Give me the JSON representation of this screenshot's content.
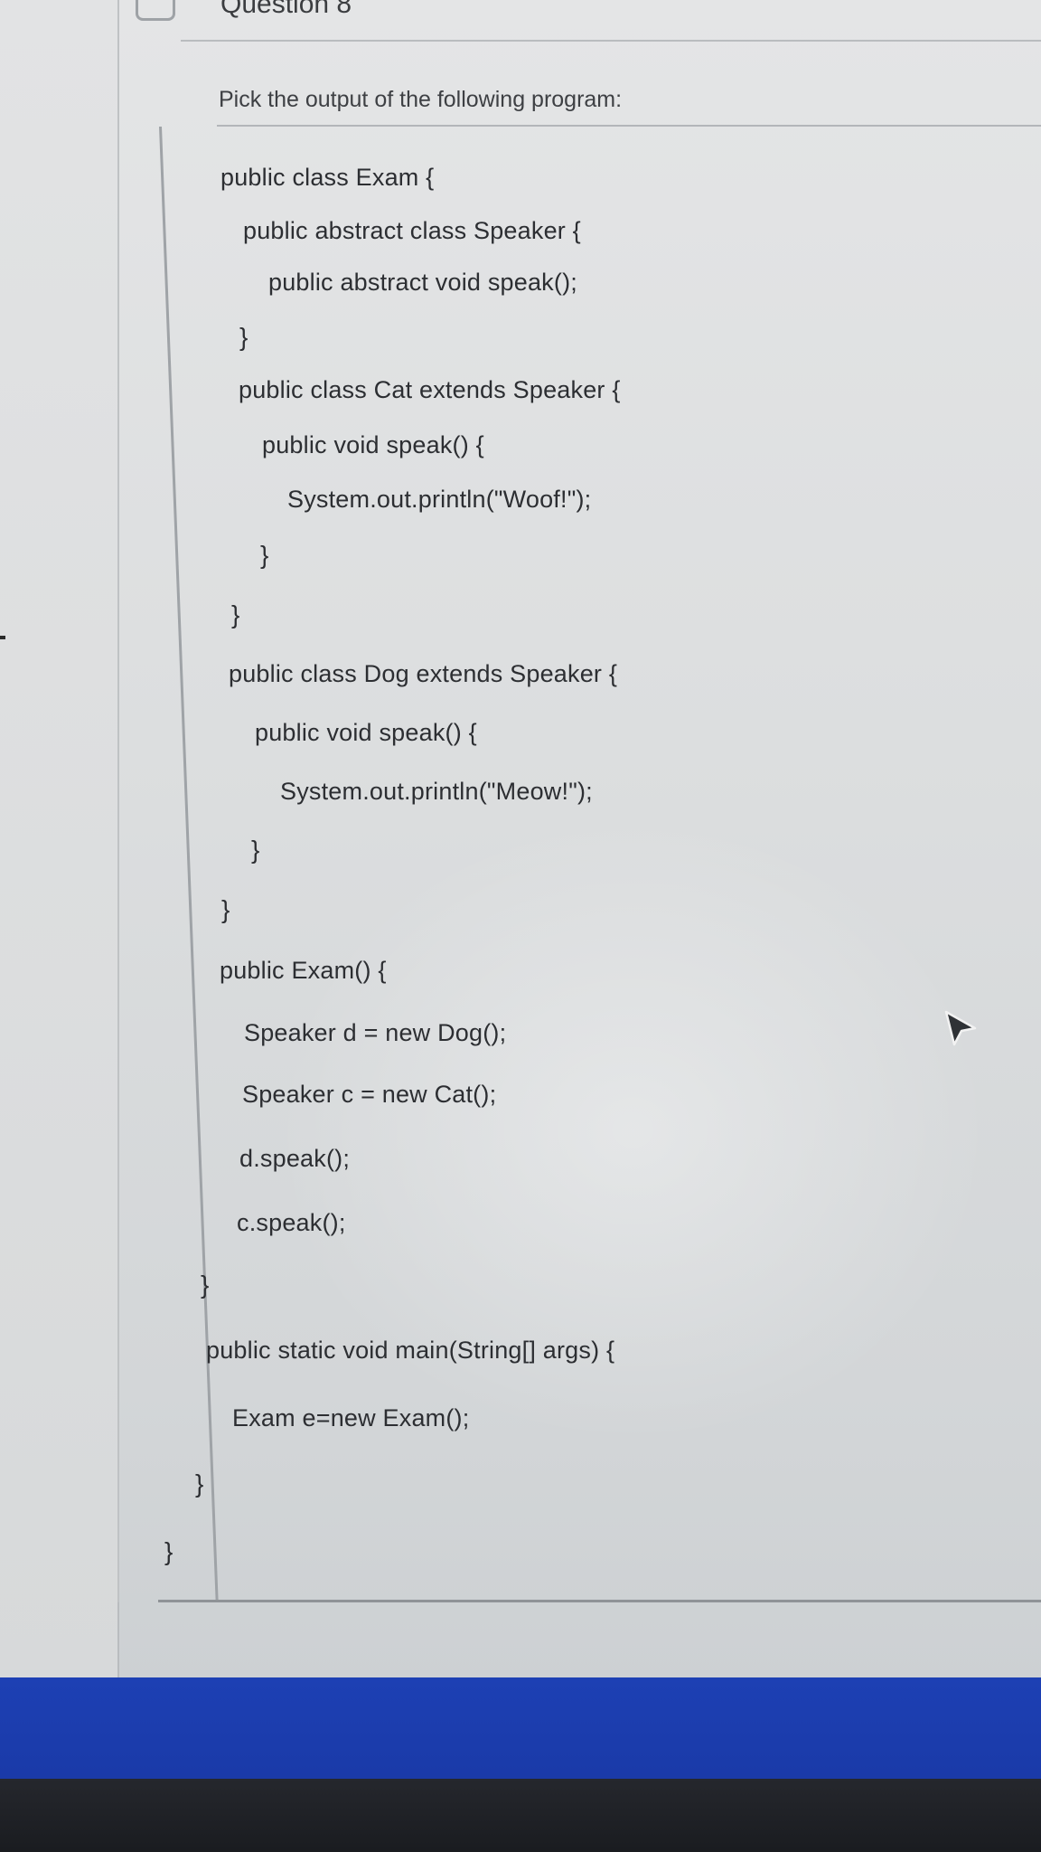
{
  "question": {
    "title": "Question 8",
    "prompt": "Pick the output of the following program:"
  },
  "code": {
    "lines": [
      "public class Exam {",
      "public abstract class Speaker {",
      "public abstract void speak();",
      "}",
      "public class Cat extends Speaker {",
      "public void speak() {",
      "System.out.println(\"Woof!\");",
      "}",
      "}",
      "public class Dog extends Speaker {",
      "public void speak() {",
      "System.out.println(\"Meow!\");",
      "}",
      "}",
      "public Exam() {",
      "Speaker d = new Dog();",
      "Speaker c = new Cat();",
      "d.speak();",
      "c.speak();",
      "}",
      "public static void main(String[] args) {",
      "Exam e=new Exam();",
      "}",
      "}"
    ]
  },
  "icons": {
    "cursor": "mouse-pointer-icon",
    "question_box": "question-flag-icon"
  },
  "colors": {
    "taskbar_blue": "#1d40b4",
    "bezel": "#1a1c20",
    "text": "#2c2e32"
  }
}
